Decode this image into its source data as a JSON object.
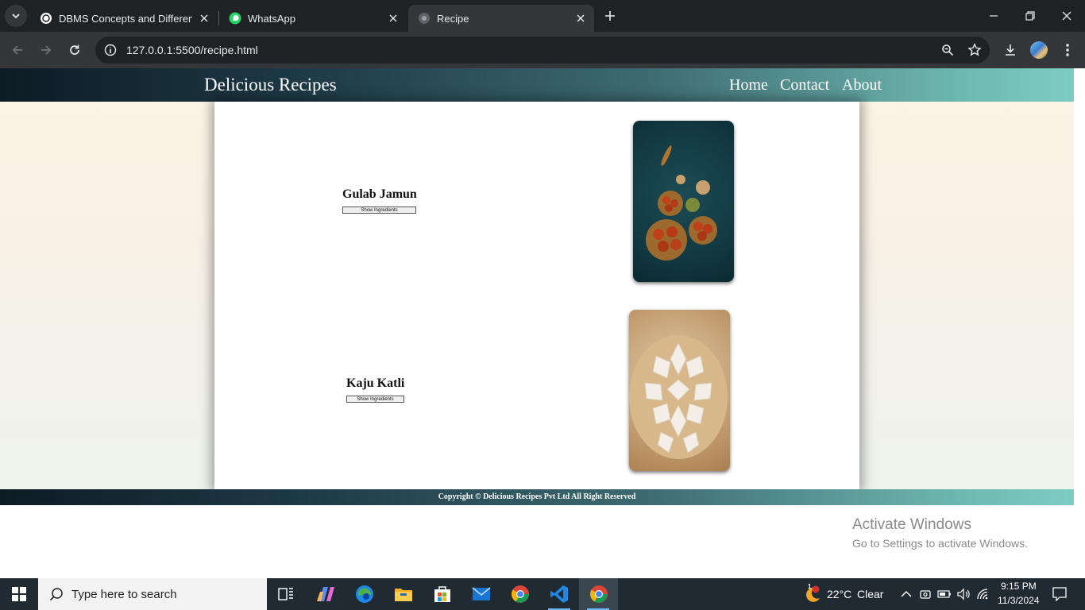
{
  "browser": {
    "tabs": [
      {
        "title": "DBMS Concepts and Differences",
        "icon": "chatgpt-icon"
      },
      {
        "title": "WhatsApp",
        "icon": "whatsapp-icon"
      },
      {
        "title": "Recipe",
        "icon": "globe-icon"
      }
    ],
    "url": "127.0.0.1:5500/recipe.html"
  },
  "site": {
    "brand": "Delicious Recipes",
    "nav": [
      "Home",
      "Contact",
      "About"
    ],
    "recipes": [
      {
        "name": "Gulab Jamun",
        "button": "Show Ingredients"
      },
      {
        "name": "Kaju Katli",
        "button": "Show Ingredients"
      }
    ],
    "footer": "Copyright © Delicious Recipes Pvt Ltd All Right Reserved"
  },
  "watermark": {
    "line1": "Activate Windows",
    "line2": "Go to Settings to activate Windows."
  },
  "taskbar": {
    "search_placeholder": "Type here to search",
    "weather": {
      "temp": "22°C",
      "condition": "Clear",
      "badge": "1"
    },
    "time": "9:15 PM",
    "date": "11/3/2024"
  },
  "colors": {
    "header_gradient_start": "#0d1b24",
    "header_gradient_end": "#7ccdc4",
    "taskbar": "#1f2a33"
  }
}
